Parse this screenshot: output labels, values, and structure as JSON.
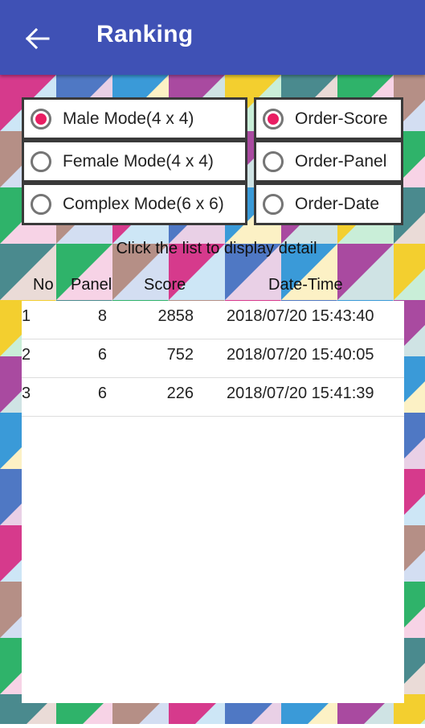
{
  "header": {
    "title": "Ranking",
    "back_icon": "arrow-left-icon",
    "background_color": "#3f51b5"
  },
  "mode_options": [
    {
      "label": "Male Mode(4 x 4)",
      "selected": true
    },
    {
      "label": "Female Mode(4 x 4)",
      "selected": false
    },
    {
      "label": "Complex Mode(6 x 6)",
      "selected": false
    }
  ],
  "order_options": [
    {
      "label": "Order-Score",
      "selected": true
    },
    {
      "label": "Order-Panel",
      "selected": false
    },
    {
      "label": "Order-Date",
      "selected": false
    }
  ],
  "hint": "Click the list to display detail",
  "table": {
    "headers": {
      "no": "No",
      "panel": "Panel",
      "score": "Score",
      "datetime": "Date-Time"
    },
    "rows": [
      {
        "no": "1",
        "panel": "8",
        "score": "2858",
        "datetime": "2018/07/20 15:43:40"
      },
      {
        "no": "2",
        "panel": "6",
        "score": "752",
        "datetime": "2018/07/20 15:40:05"
      },
      {
        "no": "3",
        "panel": "6",
        "score": "226",
        "datetime": "2018/07/20 15:41:39"
      }
    ]
  },
  "colors": {
    "accent": "#e91e63",
    "radio_off": "#757575",
    "mosaic": [
      "#d63a8c",
      "#4a8a8e",
      "#3a9ad8",
      "#b58f86",
      "#f3cf2f",
      "#4f78c4",
      "#2fb36a",
      "#a94aa0"
    ]
  }
}
